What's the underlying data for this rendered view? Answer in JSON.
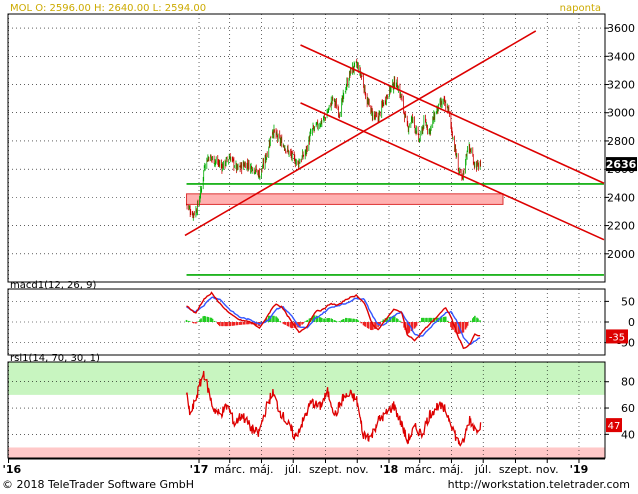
{
  "header": {
    "quote": "MOL O: 2596.00 H: 2640.00 L: 2594.00",
    "interval": "naponta"
  },
  "footer": {
    "copyright": "© 2018 TeleTrader Software GmbH",
    "url": "http://workstation.teletrader.com"
  },
  "colors": {
    "background": "#ffffff",
    "grid": "#000000",
    "candle_up": "#00aa00",
    "candle_down": "#cc0000",
    "trend_line": "#dd0000",
    "support_line": "#00aa00",
    "zone": "#ffb0b0",
    "macd_line": "#dd0000",
    "signal_line": "#3355ff",
    "rsi_line": "#dd0000",
    "rsi_overbought": "#c8f5c0",
    "rsi_oversold": "#ffc8c8",
    "last_price_bg": "#000000"
  },
  "chart_data": [
    {
      "panel": "price",
      "type": "candlestick",
      "ylim": [
        1800,
        3700
      ],
      "yticks": [
        2000,
        2200,
        2400,
        2600,
        2800,
        3000,
        3200,
        3400,
        3600
      ],
      "grid": true,
      "last_price": "2636",
      "x_axis_type": "date",
      "xlim": [
        "2015-12-31",
        "2019-02-20"
      ],
      "xticks": [
        {
          "date": "2016-01-01",
          "label": "'16",
          "bold": true
        },
        {
          "date": "2017-01-01",
          "label": "'17",
          "bold": true
        },
        {
          "date": "2017-03-01",
          "label": "márc.",
          "bold": false
        },
        {
          "date": "2017-05-01",
          "label": "máj.",
          "bold": false
        },
        {
          "date": "2017-07-01",
          "label": "júl.",
          "bold": false
        },
        {
          "date": "2017-09-01",
          "label": "szept.",
          "bold": false
        },
        {
          "date": "2017-11-01",
          "label": "nov.",
          "bold": false
        },
        {
          "date": "2018-01-01",
          "label": "'18",
          "bold": true
        },
        {
          "date": "2018-03-01",
          "label": "márc.",
          "bold": false
        },
        {
          "date": "2018-05-01",
          "label": "máj.",
          "bold": false
        },
        {
          "date": "2018-07-01",
          "label": "júl.",
          "bold": false
        },
        {
          "date": "2018-09-01",
          "label": "szept.",
          "bold": false
        },
        {
          "date": "2018-11-01",
          "label": "nov.",
          "bold": false
        },
        {
          "date": "2019-01-01",
          "label": "'19",
          "bold": true
        }
      ],
      "close_anchors": [
        [
          "2016-12-08",
          2350
        ],
        [
          "2016-12-20",
          2280
        ],
        [
          "2016-12-28",
          2320
        ],
        [
          "2017-01-05",
          2450
        ],
        [
          "2017-01-12",
          2640
        ],
        [
          "2017-01-20",
          2690
        ],
        [
          "2017-02-01",
          2660
        ],
        [
          "2017-02-15",
          2620
        ],
        [
          "2017-03-01",
          2690
        ],
        [
          "2017-03-15",
          2600
        ],
        [
          "2017-04-01",
          2640
        ],
        [
          "2017-04-15",
          2610
        ],
        [
          "2017-04-28",
          2560
        ],
        [
          "2017-05-10",
          2690
        ],
        [
          "2017-05-22",
          2880
        ],
        [
          "2017-06-01",
          2820
        ],
        [
          "2017-06-15",
          2760
        ],
        [
          "2017-06-28",
          2690
        ],
        [
          "2017-07-10",
          2640
        ],
        [
          "2017-07-25",
          2720
        ],
        [
          "2017-08-05",
          2870
        ],
        [
          "2017-08-20",
          2920
        ],
        [
          "2017-09-01",
          2970
        ],
        [
          "2017-09-15",
          3100
        ],
        [
          "2017-09-28",
          3000
        ],
        [
          "2017-10-10",
          3180
        ],
        [
          "2017-10-20",
          3300
        ],
        [
          "2017-10-31",
          3340
        ],
        [
          "2017-11-10",
          3250
        ],
        [
          "2017-11-20",
          3080
        ],
        [
          "2017-11-30",
          2990
        ],
        [
          "2017-12-10",
          2950
        ],
        [
          "2017-12-20",
          3060
        ],
        [
          "2018-01-05",
          3180
        ],
        [
          "2018-01-15",
          3220
        ],
        [
          "2018-01-25",
          3100
        ],
        [
          "2018-02-05",
          2890
        ],
        [
          "2018-02-15",
          2960
        ],
        [
          "2018-02-28",
          2800
        ],
        [
          "2018-03-10",
          2940
        ],
        [
          "2018-03-20",
          2870
        ],
        [
          "2018-04-01",
          3010
        ],
        [
          "2018-04-15",
          3080
        ],
        [
          "2018-04-25",
          3020
        ],
        [
          "2018-05-05",
          2800
        ],
        [
          "2018-05-15",
          2590
        ],
        [
          "2018-05-22",
          2520
        ],
        [
          "2018-06-01",
          2760
        ],
        [
          "2018-06-08",
          2720
        ],
        [
          "2018-06-15",
          2630
        ],
        [
          "2018-06-22",
          2620
        ],
        [
          "2018-06-26",
          2636
        ]
      ],
      "trend_lines": [
        {
          "from": [
            "2016-12-05",
            2130
          ],
          "to": [
            "2018-10-10",
            3580
          ]
        },
        {
          "from": [
            "2017-07-15",
            3480
          ],
          "to": [
            "2019-02-18",
            2500
          ]
        },
        {
          "from": [
            "2017-07-15",
            3070
          ],
          "to": [
            "2019-02-18",
            2100
          ]
        }
      ],
      "support_lines": [
        {
          "value": 2495,
          "from": "2016-12-08",
          "to": "2019-02-18"
        },
        {
          "value": 1850,
          "from": "2016-12-08",
          "to": "2019-02-18"
        }
      ],
      "zones": [
        {
          "from_value": 2350,
          "to_value": 2425,
          "from": "2016-12-08",
          "to": "2018-08-08"
        }
      ]
    },
    {
      "panel": "macd",
      "type": "line",
      "legend": "macd1(12, 26, 9)",
      "ylim": [
        -80,
        80
      ],
      "yticks": [
        -50,
        0,
        50
      ],
      "ytick_labels": [
        "-50",
        "0",
        "50"
      ],
      "last_value": "-35",
      "series": [
        {
          "name": "macd",
          "anchors": [
            [
              "2016-12-08",
              40
            ],
            [
              "2016-12-25",
              20
            ],
            [
              "2017-01-10",
              55
            ],
            [
              "2017-01-25",
              70
            ],
            [
              "2017-02-10",
              45
            ],
            [
              "2017-03-01",
              20
            ],
            [
              "2017-03-20",
              5
            ],
            [
              "2017-04-10",
              0
            ],
            [
              "2017-04-28",
              -15
            ],
            [
              "2017-05-15",
              20
            ],
            [
              "2017-05-28",
              45
            ],
            [
              "2017-06-10",
              35
            ],
            [
              "2017-06-28",
              0
            ],
            [
              "2017-07-12",
              -25
            ],
            [
              "2017-07-28",
              -10
            ],
            [
              "2017-08-12",
              25
            ],
            [
              "2017-08-28",
              30
            ],
            [
              "2017-09-10",
              45
            ],
            [
              "2017-09-25",
              40
            ],
            [
              "2017-10-10",
              55
            ],
            [
              "2017-10-31",
              65
            ],
            [
              "2017-11-15",
              45
            ],
            [
              "2017-11-28",
              0
            ],
            [
              "2017-12-10",
              -20
            ],
            [
              "2017-12-22",
              0
            ],
            [
              "2018-01-10",
              30
            ],
            [
              "2018-01-25",
              25
            ],
            [
              "2018-02-05",
              -30
            ],
            [
              "2018-02-20",
              -45
            ],
            [
              "2018-03-05",
              -25
            ],
            [
              "2018-03-20",
              -5
            ],
            [
              "2018-04-05",
              15
            ],
            [
              "2018-04-20",
              35
            ],
            [
              "2018-05-01",
              10
            ],
            [
              "2018-05-12",
              -30
            ],
            [
              "2018-05-25",
              -65
            ],
            [
              "2018-06-05",
              -55
            ],
            [
              "2018-06-15",
              -30
            ],
            [
              "2018-06-26",
              -35
            ]
          ]
        },
        {
          "name": "signal",
          "anchors": [
            [
              "2016-12-08",
              35
            ],
            [
              "2016-12-25",
              25
            ],
            [
              "2017-01-10",
              40
            ],
            [
              "2017-01-25",
              60
            ],
            [
              "2017-02-10",
              55
            ],
            [
              "2017-03-01",
              30
            ],
            [
              "2017-03-20",
              12
            ],
            [
              "2017-04-10",
              5
            ],
            [
              "2017-04-28",
              -5
            ],
            [
              "2017-05-15",
              5
            ],
            [
              "2017-05-28",
              30
            ],
            [
              "2017-06-10",
              38
            ],
            [
              "2017-06-28",
              15
            ],
            [
              "2017-07-12",
              -12
            ],
            [
              "2017-07-28",
              -15
            ],
            [
              "2017-08-12",
              8
            ],
            [
              "2017-08-28",
              22
            ],
            [
              "2017-09-10",
              35
            ],
            [
              "2017-09-25",
              40
            ],
            [
              "2017-10-10",
              45
            ],
            [
              "2017-10-31",
              58
            ],
            [
              "2017-11-15",
              55
            ],
            [
              "2017-11-28",
              20
            ],
            [
              "2017-12-10",
              -5
            ],
            [
              "2017-12-22",
              -8
            ],
            [
              "2018-01-10",
              15
            ],
            [
              "2018-01-25",
              25
            ],
            [
              "2018-02-05",
              0
            ],
            [
              "2018-02-20",
              -30
            ],
            [
              "2018-03-05",
              -35
            ],
            [
              "2018-03-20",
              -15
            ],
            [
              "2018-04-05",
              5
            ],
            [
              "2018-04-20",
              22
            ],
            [
              "2018-05-01",
              25
            ],
            [
              "2018-05-12",
              0
            ],
            [
              "2018-05-25",
              -40
            ],
            [
              "2018-06-05",
              -55
            ],
            [
              "2018-06-15",
              -45
            ],
            [
              "2018-06-26",
              -38
            ]
          ]
        }
      ],
      "histogram": "macd minus signal"
    },
    {
      "panel": "rsi",
      "type": "line",
      "legend": "rsi1(14, 70, 30, 1)",
      "ylim": [
        22,
        95
      ],
      "yticks": [
        40,
        60,
        80
      ],
      "ytick_labels": [
        "40",
        "60",
        "80"
      ],
      "overbought": 70,
      "oversold": 30,
      "last_value": "47",
      "anchors": [
        [
          "2016-12-08",
          70
        ],
        [
          "2016-12-15",
          55
        ],
        [
          "2016-12-22",
          62
        ],
        [
          "2017-01-03",
          78
        ],
        [
          "2017-01-10",
          87
        ],
        [
          "2017-01-18",
          75
        ],
        [
          "2017-01-28",
          60
        ],
        [
          "2017-02-10",
          55
        ],
        [
          "2017-02-25",
          62
        ],
        [
          "2017-03-10",
          48
        ],
        [
          "2017-03-25",
          55
        ],
        [
          "2017-04-10",
          45
        ],
        [
          "2017-04-25",
          40
        ],
        [
          "2017-05-10",
          60
        ],
        [
          "2017-05-22",
          72
        ],
        [
          "2017-06-05",
          58
        ],
        [
          "2017-06-20",
          48
        ],
        [
          "2017-07-05",
          38
        ],
        [
          "2017-07-20",
          50
        ],
        [
          "2017-08-05",
          65
        ],
        [
          "2017-08-20",
          60
        ],
        [
          "2017-09-05",
          72
        ],
        [
          "2017-09-20",
          55
        ],
        [
          "2017-10-05",
          68
        ],
        [
          "2017-10-20",
          70
        ],
        [
          "2017-10-31",
          66
        ],
        [
          "2017-11-12",
          40
        ],
        [
          "2017-11-28",
          38
        ],
        [
          "2017-12-10",
          50
        ],
        [
          "2017-12-25",
          55
        ],
        [
          "2018-01-10",
          62
        ],
        [
          "2018-01-25",
          48
        ],
        [
          "2018-02-05",
          35
        ],
        [
          "2018-02-20",
          45
        ],
        [
          "2018-03-05",
          40
        ],
        [
          "2018-03-20",
          55
        ],
        [
          "2018-04-05",
          62
        ],
        [
          "2018-04-20",
          58
        ],
        [
          "2018-05-01",
          48
        ],
        [
          "2018-05-12",
          35
        ],
        [
          "2018-05-22",
          32
        ],
        [
          "2018-06-05",
          52
        ],
        [
          "2018-06-15",
          44
        ],
        [
          "2018-06-26",
          47
        ]
      ]
    }
  ]
}
